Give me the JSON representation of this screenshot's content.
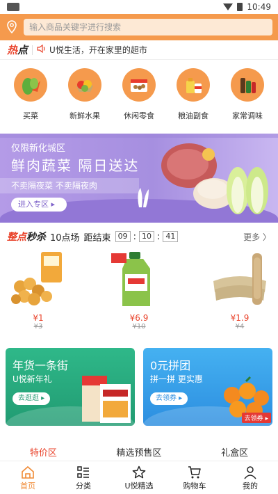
{
  "status_bar": {
    "time": "10:49"
  },
  "search": {
    "placeholder": "输入商品关键字进行搜索"
  },
  "hot": {
    "tag_red": "热",
    "tag_black": "点",
    "text": "U悦生活，开在家里的超市"
  },
  "categories": [
    {
      "label": "买菜",
      "icon": "vegetables-icon"
    },
    {
      "label": "新鲜水果",
      "icon": "fruit-icon"
    },
    {
      "label": "休闲零食",
      "icon": "snacks-icon"
    },
    {
      "label": "粮油副食",
      "icon": "grain-oil-icon"
    },
    {
      "label": "家常调味",
      "icon": "seasoning-icon"
    }
  ],
  "banner": {
    "line1": "仅限新化城区",
    "line2": "鲜肉蔬菜  隔日送达",
    "line3": "不卖隔夜菜 不卖隔夜肉",
    "button": "进入专区 ▸"
  },
  "flash_sale": {
    "title_red": "整点",
    "title_black": "秒杀",
    "slot": "10点场",
    "end_label": "距结束",
    "hours": "09",
    "minutes": "10",
    "seconds": "41",
    "more": "更多 〉"
  },
  "products": [
    {
      "price": "¥1",
      "orig": "¥3",
      "icon": "corn-snack-icon"
    },
    {
      "price": "¥6.9",
      "orig": "¥10",
      "icon": "detergent-bottle-icon"
    },
    {
      "price": "¥1.9",
      "orig": "¥4",
      "icon": "dried-noodle-icon"
    }
  ],
  "cards": [
    {
      "title": "年货一条街",
      "subtitle": "U悦新年礼",
      "button": "去逛逛 ▸"
    },
    {
      "title": "0元拼团",
      "subtitle": "拼一拼  更实惠",
      "button": "去领券 ▸",
      "badge": "去领券 ▸"
    }
  ],
  "sections": [
    "特价区",
    "精选预售区",
    "礼盒区"
  ],
  "tabs": [
    {
      "label": "首页",
      "icon": "home-icon",
      "active": true
    },
    {
      "label": "分类",
      "icon": "category-list-icon"
    },
    {
      "label": "U悦精选",
      "icon": "star-icon"
    },
    {
      "label": "购物车",
      "icon": "cart-icon"
    },
    {
      "label": "我的",
      "icon": "user-icon"
    }
  ],
  "colors": {
    "accent": "#f59a4d",
    "red": "#e9422a",
    "banner": "#a68fe0",
    "green_card": "#219b72",
    "blue_card": "#2c8ee0"
  }
}
